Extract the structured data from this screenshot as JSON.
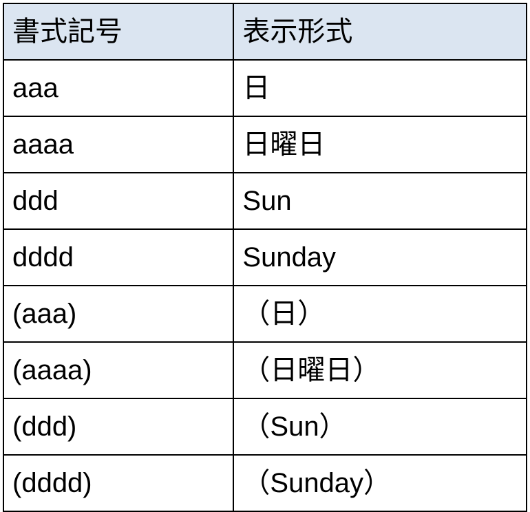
{
  "table": {
    "headers": {
      "format_code": "書式記号",
      "display_format": "表示形式"
    },
    "rows": [
      {
        "format": "aaa",
        "display": "日"
      },
      {
        "format": "aaaa",
        "display": "日曜日"
      },
      {
        "format": "ddd",
        "display": "Sun"
      },
      {
        "format": "dddd",
        "display": "Sunday"
      },
      {
        "format": "(aaa)",
        "display": "（日）"
      },
      {
        "format": "(aaaa)",
        "display": "（日曜日）"
      },
      {
        "format": "(ddd)",
        "display": "（Sun）"
      },
      {
        "format": "(dddd)",
        "display": "（Sunday）"
      }
    ]
  }
}
